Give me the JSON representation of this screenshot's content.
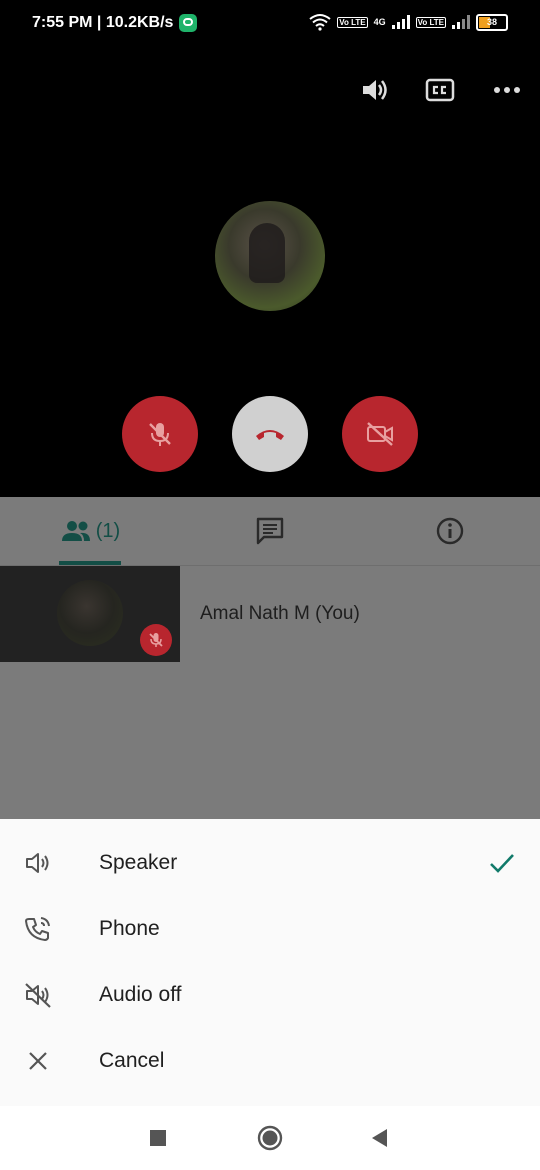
{
  "status_bar": {
    "time_speed": "7:55 PM | 10.2KB/s",
    "volte_1": "Vo LTE",
    "network": "4G",
    "volte_2": "Vo LTE",
    "battery": "38"
  },
  "call": {
    "controls": [
      "mute-mic",
      "end-call",
      "camera-off"
    ]
  },
  "tabs": {
    "people_count": "(1)"
  },
  "participant": {
    "name": "Amal Nath M (You)"
  },
  "audio_sheet": {
    "items": [
      {
        "label": "Speaker",
        "icon": "speaker-icon",
        "selected": true
      },
      {
        "label": "Phone",
        "icon": "phone-icon",
        "selected": false
      },
      {
        "label": "Audio off",
        "icon": "audio-off-icon",
        "selected": false
      },
      {
        "label": "Cancel",
        "icon": "close-icon",
        "selected": false
      }
    ]
  },
  "colors": {
    "accent": "#134e46",
    "end_call_red": "#b8262e",
    "check_teal": "#117a6a"
  }
}
